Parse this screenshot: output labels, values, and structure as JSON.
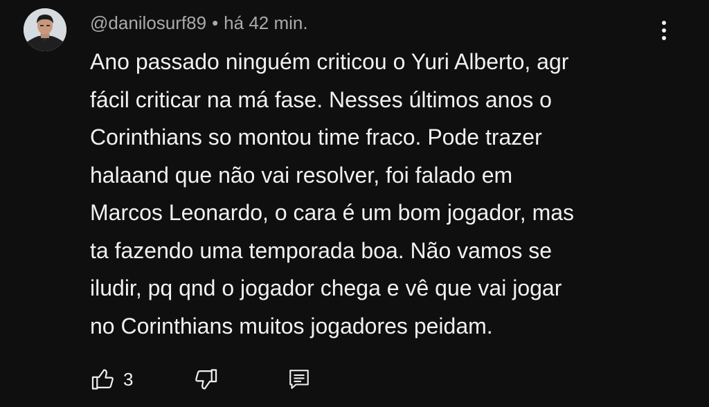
{
  "comment": {
    "username": "@danilosurf89",
    "separator": "•",
    "time": "há 42 min.",
    "text": "Ano passado ninguém criticou o Yuri Alberto, agr\nfácil criticar na má fase. Nesses últimos anos o\nCorinthians so montou time fraco. Pode trazer\nhalaand que não vai resolver, foi falado em\nMarcos Leonardo, o cara é um bom jogador, mas\nta fazendo uma temporada boa. Não vamos se\niludir, pq qnd o jogador chega e vê que vai jogar\nno Corinthians muitos jogadores peidam.",
    "like_count": "3"
  },
  "icons": {
    "like": "thumbs-up-icon",
    "dislike": "thumbs-down-icon",
    "reply": "reply-comment-icon",
    "menu": "more-vertical-icon"
  },
  "colors": {
    "background": "#0f0f0f",
    "text": "#f1f1f1",
    "secondary_text": "#aaaaaa"
  }
}
